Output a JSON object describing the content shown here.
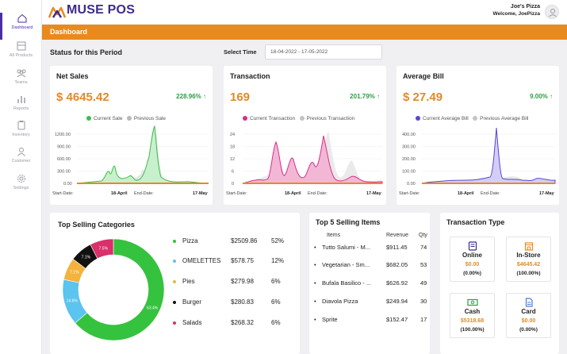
{
  "app": {
    "logo_text": "MUSE POS",
    "store_name": "Joe's Pizza",
    "welcome": "Welcome, JoePizza"
  },
  "sidebar": {
    "items": [
      {
        "label": "Dashboard",
        "icon": "home-icon"
      },
      {
        "label": "All Products",
        "icon": "products-icon"
      },
      {
        "label": "Teams",
        "icon": "teams-icon"
      },
      {
        "label": "Reports",
        "icon": "reports-icon"
      },
      {
        "label": "Inventory",
        "icon": "inventory-icon"
      },
      {
        "label": "Customer",
        "icon": "customer-icon"
      },
      {
        "label": "Settings",
        "icon": "settings-icon"
      }
    ]
  },
  "header": {
    "title": "Dashboard"
  },
  "period": {
    "title": "Status for this Period",
    "select_label": "Select Time",
    "date_range": "18-04-2022 - 17-05-2022"
  },
  "footer_labels": {
    "start": "Start-Date:",
    "start_value": "18-April",
    "end": "End-Date:",
    "end_value": "17-May"
  },
  "net_sales": {
    "title": "Net Sales",
    "value": "$ 4645.42",
    "change": "228.96%",
    "legend_current": "Current Sale",
    "legend_previous": "Previous Sale",
    "y_ticks": [
      "1200.00",
      "900.00",
      "600.00",
      "300.00",
      "0.00"
    ]
  },
  "transaction": {
    "title": "Transaction",
    "value": "169",
    "change": "201.79%",
    "legend_current": "Current Transaction",
    "legend_previous": "Previous Transaction",
    "y_ticks": [
      "24",
      "18",
      "12",
      "6",
      "0"
    ]
  },
  "average_bill": {
    "title": "Average Bill",
    "value": "$ 27.49",
    "change": "9.00%",
    "legend_current": "Current Average Bill",
    "legend_previous": "Previous Average Bill",
    "y_ticks": [
      "400.00",
      "300.00",
      "200.00",
      "100.00",
      "0.00"
    ]
  },
  "colors": {
    "accent": "#e98a1d",
    "brand": "#3d2a8a",
    "net_current": "#3bbf4a",
    "net_previous": "#b9b9b9",
    "tx_current": "#d92f8c",
    "tx_previous": "#c4c4c4",
    "avg_current": "#5a45d6",
    "avg_previous": "#c4c4c4"
  },
  "categories": {
    "title": "Top Selling Categories",
    "items": [
      {
        "name": "Pizza",
        "amount": "$2509.86",
        "percent": "52%",
        "color": "#35c23f",
        "slice_label": "63.4%"
      },
      {
        "name": "OMELETTES",
        "amount": "$578.75",
        "percent": "12%",
        "color": "#5bc4ef",
        "slice_label": "14.6%"
      },
      {
        "name": "Pies",
        "amount": "$279.98",
        "percent": "6%",
        "color": "#f4b33c",
        "slice_label": "7.1%"
      },
      {
        "name": "Burger",
        "amount": "$280.83",
        "percent": "6%",
        "color": "#111111",
        "slice_label": "7.1%"
      },
      {
        "name": "Salads",
        "amount": "$268.32",
        "percent": "6%",
        "color": "#d92f6a",
        "slice_label": "7.5%"
      }
    ]
  },
  "top_items": {
    "title": "Top 5 Selling Items",
    "headers": {
      "items": "Items",
      "revenue": "Revenue",
      "qty": "Qty"
    },
    "rows": [
      {
        "name": "Tutto Salumi - M...",
        "revenue": "$911.45",
        "qty": "74"
      },
      {
        "name": "Vegetarian - Sm...",
        "revenue": "$682.05",
        "qty": "53"
      },
      {
        "name": "Bufala Basilico - ...",
        "revenue": "$626.92",
        "qty": "49"
      },
      {
        "name": "Diavola Pizza",
        "revenue": "$249.94",
        "qty": "30"
      },
      {
        "name": "Sprite",
        "revenue": "$152.47",
        "qty": "17"
      }
    ]
  },
  "transaction_type": {
    "title": "Transaction Type",
    "boxes": [
      {
        "label": "Online",
        "amount": "$0.00",
        "percent": "(0.00%)",
        "icon": "online-icon",
        "icon_color": "#3d2a8a"
      },
      {
        "label": "In-Store",
        "amount": "$4645.42",
        "percent": "(100.00%)",
        "icon": "store-icon",
        "icon_color": "#e98a1d"
      },
      {
        "label": "Cash",
        "amount": "$5318.68",
        "percent": "(100.00%)",
        "icon": "cash-icon",
        "icon_color": "#2e9e46"
      },
      {
        "label": "Card",
        "amount": "$0.00",
        "percent": "(0.00%)",
        "icon": "card-icon",
        "icon_color": "#4a7fd6"
      }
    ]
  }
}
